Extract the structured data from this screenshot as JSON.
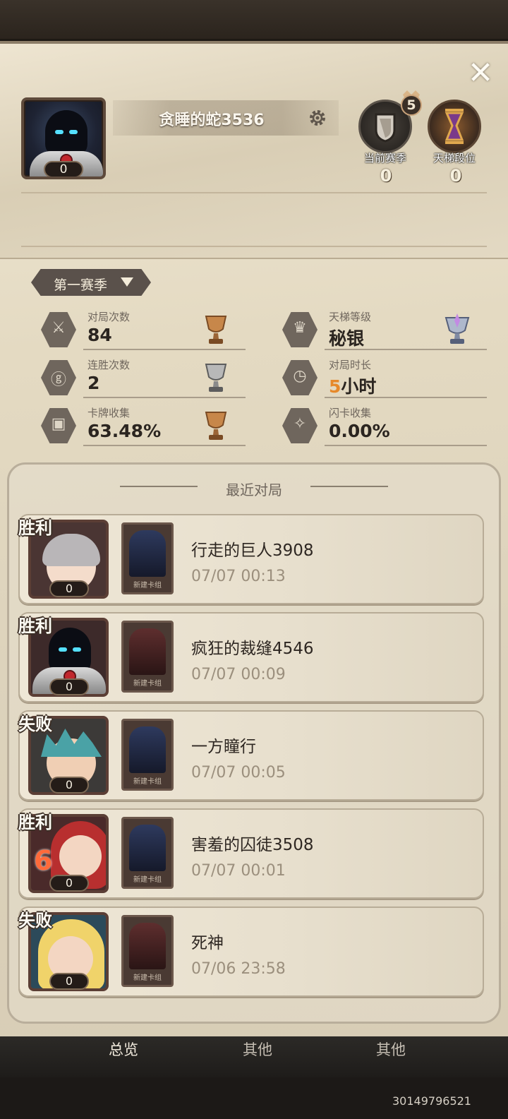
{
  "profile": {
    "name": "贪睡的蛇3536",
    "avatar_count": "0",
    "level": "5",
    "current_season_label": "当前赛季",
    "current_season_value": "0",
    "ladder_rank_label": "天梯段位",
    "ladder_rank_value": "0"
  },
  "season_selector": {
    "label": "第一赛季"
  },
  "stats": [
    {
      "label": "对局次数",
      "value": "84",
      "icon": "crossed-swords-icon",
      "trophy": "bronze-trophy-icon"
    },
    {
      "label": "天梯等级",
      "value": "秘银",
      "icon": "crown-icon",
      "trophy": "mithril-trophy-icon"
    },
    {
      "label": "连胜次数",
      "value": "2",
      "icon": "streak-icon",
      "trophy": "silver-trophy-icon"
    },
    {
      "label": "对局时长",
      "value_number": "5",
      "value_unit": "小时",
      "icon": "clock-icon",
      "trophy": ""
    },
    {
      "label": "卡牌收集",
      "value": "63.48%",
      "icon": "card-collection-icon",
      "trophy": "bronze-trophy-icon"
    },
    {
      "label": "闪卡收集",
      "value": "0.00%",
      "icon": "flash-card-icon",
      "trophy": ""
    }
  ],
  "recent": {
    "title": "最近对局",
    "matches": [
      {
        "result": "胜利",
        "count": "0",
        "deck": "新建卡组",
        "opponent": "行走的巨人3908",
        "time": "07/07 00:13"
      },
      {
        "result": "胜利",
        "count": "0",
        "deck": "新建卡组",
        "opponent": "疯狂的裁缝4546",
        "time": "07/07 00:09"
      },
      {
        "result": "失败",
        "count": "0",
        "deck": "新建卡组",
        "opponent": "一方瞳行",
        "time": "07/07 00:05"
      },
      {
        "result": "胜利",
        "count": "0",
        "deck": "新建卡组",
        "opponent": "害羞的囚徒3508",
        "time": "07/07 00:01",
        "badge": "6"
      },
      {
        "result": "失败",
        "count": "0",
        "deck": "新建卡组",
        "opponent": "死神",
        "time": "07/06 23:58"
      }
    ]
  },
  "nav": {
    "tab1": "总览",
    "tab2": "其他",
    "tab3": "其他"
  },
  "footer": {
    "uid": "301497965​21"
  },
  "colors": {
    "accent": "#e6892b",
    "panel": "#e4dac2",
    "dark": "#241c18"
  }
}
